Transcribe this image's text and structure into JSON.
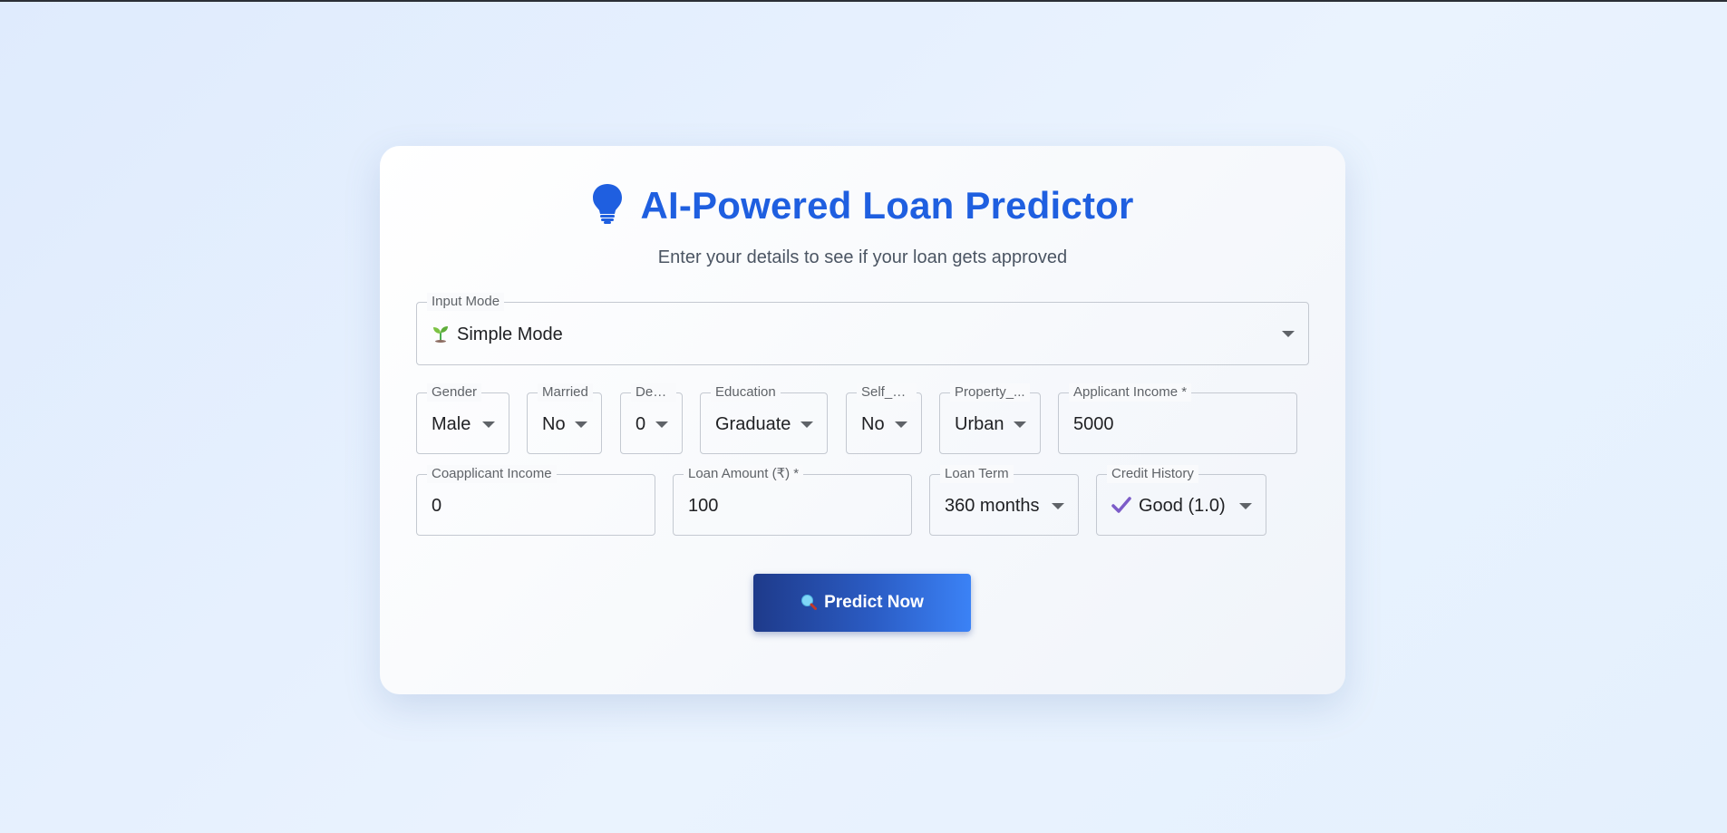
{
  "header": {
    "icon": "lightbulb-icon",
    "title": "AI-Powered Loan Predictor",
    "subtitle": "Enter your details to see if your loan gets approved"
  },
  "input_mode": {
    "label": "Input Mode",
    "icon": "seedling-icon",
    "value": "Simple Mode"
  },
  "fields": {
    "gender": {
      "label": "Gender",
      "value": "Male"
    },
    "married": {
      "label": "Married",
      "value": "No"
    },
    "dependents": {
      "label": "Dep...",
      "value": "0"
    },
    "education": {
      "label": "Education",
      "value": "Graduate"
    },
    "self_employed": {
      "label": "Self_E...",
      "value": "No"
    },
    "property_area": {
      "label": "Property_...",
      "value": "Urban"
    },
    "applicant_income": {
      "label": "Applicant Income *",
      "value": "5000"
    },
    "coapplicant_income": {
      "label": "Coapplicant Income",
      "value": "0"
    },
    "loan_amount": {
      "label": "Loan Amount (₹) *",
      "value": "100"
    },
    "loan_term": {
      "label": "Loan Term",
      "value": "360 months"
    },
    "credit_history": {
      "label": "Credit History",
      "icon": "check-mark-icon",
      "value": "Good (1.0)"
    }
  },
  "actions": {
    "predict_icon": "magnifier-icon",
    "predict_label": "Predict Now"
  },
  "colors": {
    "accent": "#1f5fe0",
    "button_start": "#1e3a8a",
    "button_end": "#3b82f6",
    "check": "#7c5cc8"
  }
}
